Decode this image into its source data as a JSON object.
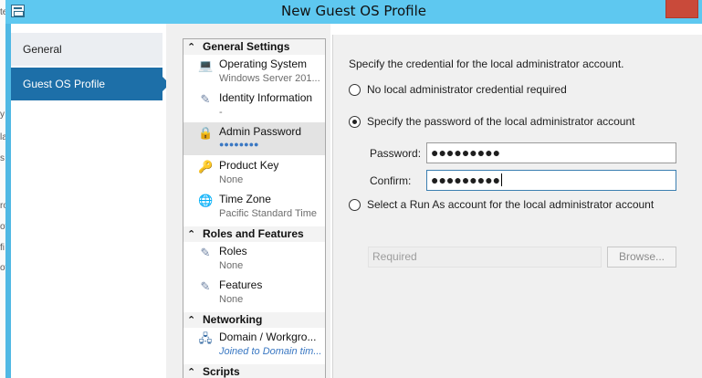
{
  "window": {
    "title": "New Guest OS Profile"
  },
  "nav": {
    "items": [
      {
        "label": "General"
      },
      {
        "label": "Guest OS Profile"
      }
    ]
  },
  "settings": {
    "sections": [
      {
        "title": "General Settings",
        "items": [
          {
            "name": "Operating System",
            "value": "Windows Server 201...",
            "icon": "os-icon"
          },
          {
            "name": "Identity Information",
            "value": "-",
            "icon": "identity-icon"
          },
          {
            "name": "Admin Password",
            "value": "●●●●●●●●",
            "icon": "lock-icon"
          },
          {
            "name": "Product Key",
            "value": "None",
            "icon": "key-icon"
          },
          {
            "name": "Time Zone",
            "value": "Pacific Standard Time",
            "icon": "globe-icon"
          }
        ]
      },
      {
        "title": "Roles and Features",
        "items": [
          {
            "name": "Roles",
            "value": "None",
            "icon": "roles-icon"
          },
          {
            "name": "Features",
            "value": "None",
            "icon": "features-icon"
          }
        ]
      },
      {
        "title": "Networking",
        "items": [
          {
            "name": "Domain / Workgro...",
            "value": "Joined to Domain tim...",
            "icon": "network-icon"
          }
        ]
      },
      {
        "title": "Scripts",
        "items": []
      }
    ]
  },
  "content": {
    "intro": "Specify the credential for the local administrator account.",
    "option_no_credential": "No local administrator credential required",
    "option_specify_password": "Specify the password of the local administrator account",
    "password_label": "Password:",
    "password_value": "●●●●●●●●●",
    "confirm_label": "Confirm:",
    "confirm_value": "●●●●●●●●●",
    "option_run_as": "Select a Run As account for the local administrator account",
    "run_as_placeholder": "Required",
    "browse_label": "Browse...",
    "selected_option": "specify_password"
  },
  "colors": {
    "titlebar": "#5ec8f0",
    "nav_active": "#1d6fa8",
    "close_button": "#c94a3a"
  }
}
